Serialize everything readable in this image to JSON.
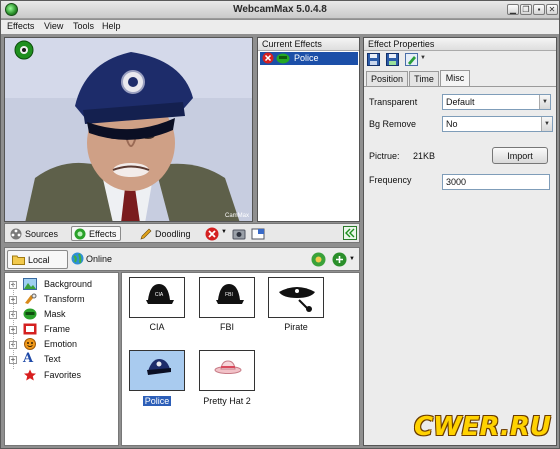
{
  "window": {
    "title": "WebcamMax  5.0.4.8",
    "controls": [
      "minimize",
      "restore",
      "skin",
      "close"
    ]
  },
  "menu": [
    "Effects",
    "View",
    "Tools",
    "Help"
  ],
  "video": {
    "cam_badge_icon": "webcam-icon",
    "watermark": "CamMax"
  },
  "current_effects": {
    "header": "Current Effects",
    "items": [
      {
        "label": "Police"
      }
    ]
  },
  "effect_properties": {
    "header": "Effect Properties",
    "toolbar_icons": [
      "save-icon",
      "save-as-icon",
      "edit-icon"
    ],
    "tabs": [
      "Position",
      "Time",
      "Misc"
    ],
    "active_tab": "Misc",
    "transparent": {
      "label": "Transparent",
      "value": "Default"
    },
    "bg_remove": {
      "label": "Bg Remove",
      "value": "No"
    },
    "picture": {
      "label": "Pictrue:",
      "size": "21KB",
      "button": "Import"
    },
    "frequency": {
      "label": "Frequency",
      "value": "3000"
    }
  },
  "middle_toolbar": {
    "tabs": [
      "Sources",
      "Effects",
      "Doodling"
    ],
    "active_tab": "Effects"
  },
  "library": {
    "tabs": [
      "Local",
      "Online"
    ],
    "active_tab": "Local",
    "categories": [
      {
        "label": "Background",
        "expandable": true
      },
      {
        "label": "Transform",
        "expandable": true
      },
      {
        "label": "Mask",
        "expandable": true
      },
      {
        "label": "Frame",
        "expandable": true
      },
      {
        "label": "Emotion",
        "expandable": true
      },
      {
        "label": "Text",
        "expandable": true
      },
      {
        "label": "Favorites",
        "expandable": false
      }
    ],
    "items": [
      {
        "label": "CIA",
        "cap_text": "CIA",
        "selected": false
      },
      {
        "label": "FBI",
        "cap_text": "FBI",
        "selected": false
      },
      {
        "label": "Pirate",
        "selected": false
      },
      {
        "label": "Police",
        "selected": true
      },
      {
        "label": "Pretty Hat 2",
        "selected": false
      }
    ]
  },
  "site_watermark": "CWER.RU",
  "colors": {
    "selection": "#1c4fa8",
    "panel_border": "#555555",
    "background": "#8f8f8f"
  }
}
